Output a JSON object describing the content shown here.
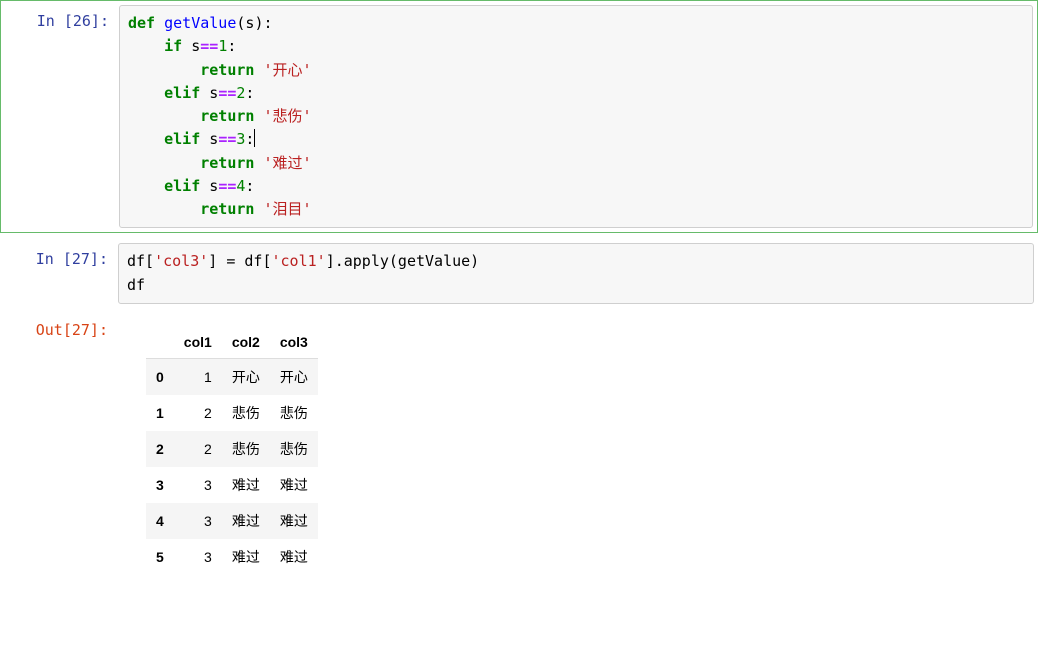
{
  "cells": {
    "c1": {
      "prompt": "In  [26]:",
      "tokens": {
        "def": "def",
        "fname": "getValue",
        "if": "if",
        "elif": "elif",
        "return": "return",
        "eq": "==",
        "n1": "1",
        "n2": "2",
        "n3": "3",
        "n4": "4",
        "s_param": "s",
        "str1": "'开心'",
        "str2": "'悲伤'",
        "str3": "'难过'",
        "str4": "'泪目'"
      }
    },
    "c2": {
      "prompt": "In  [27]:",
      "line1_a": "df[",
      "line1_str1": "'col3'",
      "line1_b": "] = df[",
      "line1_str2": "'col1'",
      "line1_c": "].apply(getValue)",
      "line2": "df"
    },
    "c3": {
      "prompt": "Out[27]:",
      "headers": [
        "",
        "col1",
        "col2",
        "col3"
      ],
      "rows": [
        {
          "idx": "0",
          "col1": "1",
          "col2": "开心",
          "col3": "开心"
        },
        {
          "idx": "1",
          "col1": "2",
          "col2": "悲伤",
          "col3": "悲伤"
        },
        {
          "idx": "2",
          "col1": "2",
          "col2": "悲伤",
          "col3": "悲伤"
        },
        {
          "idx": "3",
          "col1": "3",
          "col2": "难过",
          "col3": "难过"
        },
        {
          "idx": "4",
          "col1": "3",
          "col2": "难过",
          "col3": "难过"
        },
        {
          "idx": "5",
          "col1": "3",
          "col2": "难过",
          "col3": "难过"
        }
      ]
    }
  }
}
